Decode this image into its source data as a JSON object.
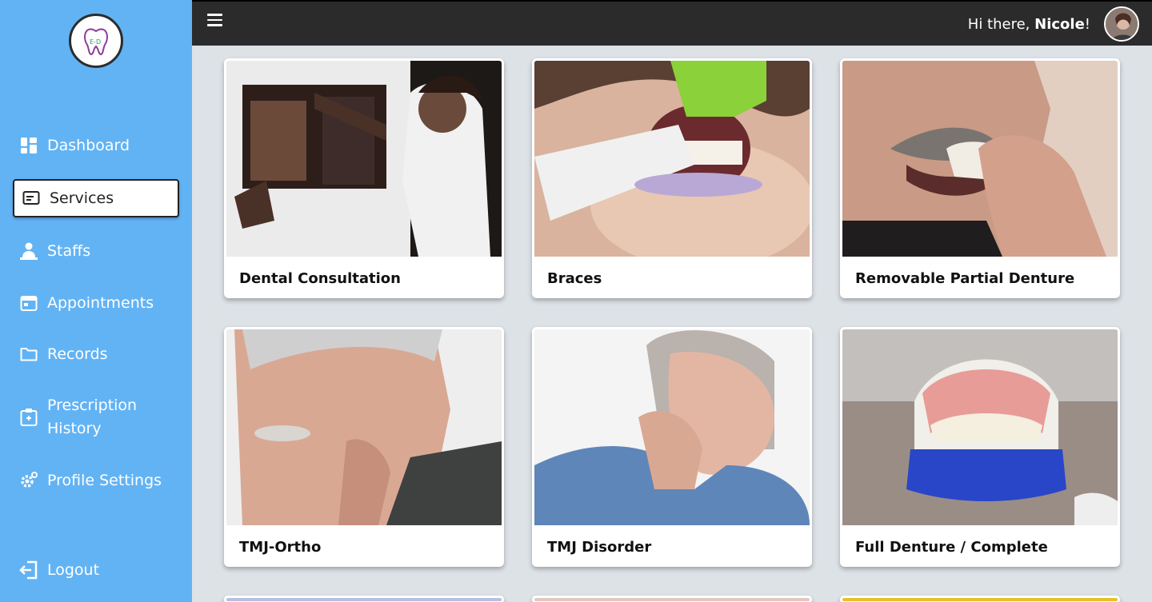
{
  "sidebar": {
    "logo_icon": "tooth-logo-icon",
    "items": [
      {
        "label": "Dashboard",
        "icon": "dashboard-icon"
      },
      {
        "label": "Services",
        "icon": "services-icon",
        "active": true
      },
      {
        "label": "Staffs",
        "icon": "staff-icon"
      },
      {
        "label": "Appointments",
        "icon": "calendar-icon"
      },
      {
        "label": "Records",
        "icon": "folder-icon"
      },
      {
        "label": "Prescription History",
        "line1": "Prescription",
        "line2": "History",
        "icon": "prescription-icon"
      },
      {
        "label": "Profile Settings",
        "icon": "gear-icon"
      },
      {
        "label": "Logout",
        "icon": "logout-icon"
      }
    ],
    "bg_color": "#62b3f4"
  },
  "topbar": {
    "greeting_prefix": "Hi there, ",
    "user_name": "Nicole",
    "greeting_suffix": "!",
    "bg_color": "#2b2b2b"
  },
  "services": [
    {
      "title": "Dental Consultation"
    },
    {
      "title": "Braces"
    },
    {
      "title": "Removable Partial Denture"
    },
    {
      "title": "TMJ-Ortho"
    },
    {
      "title": "TMJ Disorder"
    },
    {
      "title": "Full Denture / Complete"
    }
  ]
}
